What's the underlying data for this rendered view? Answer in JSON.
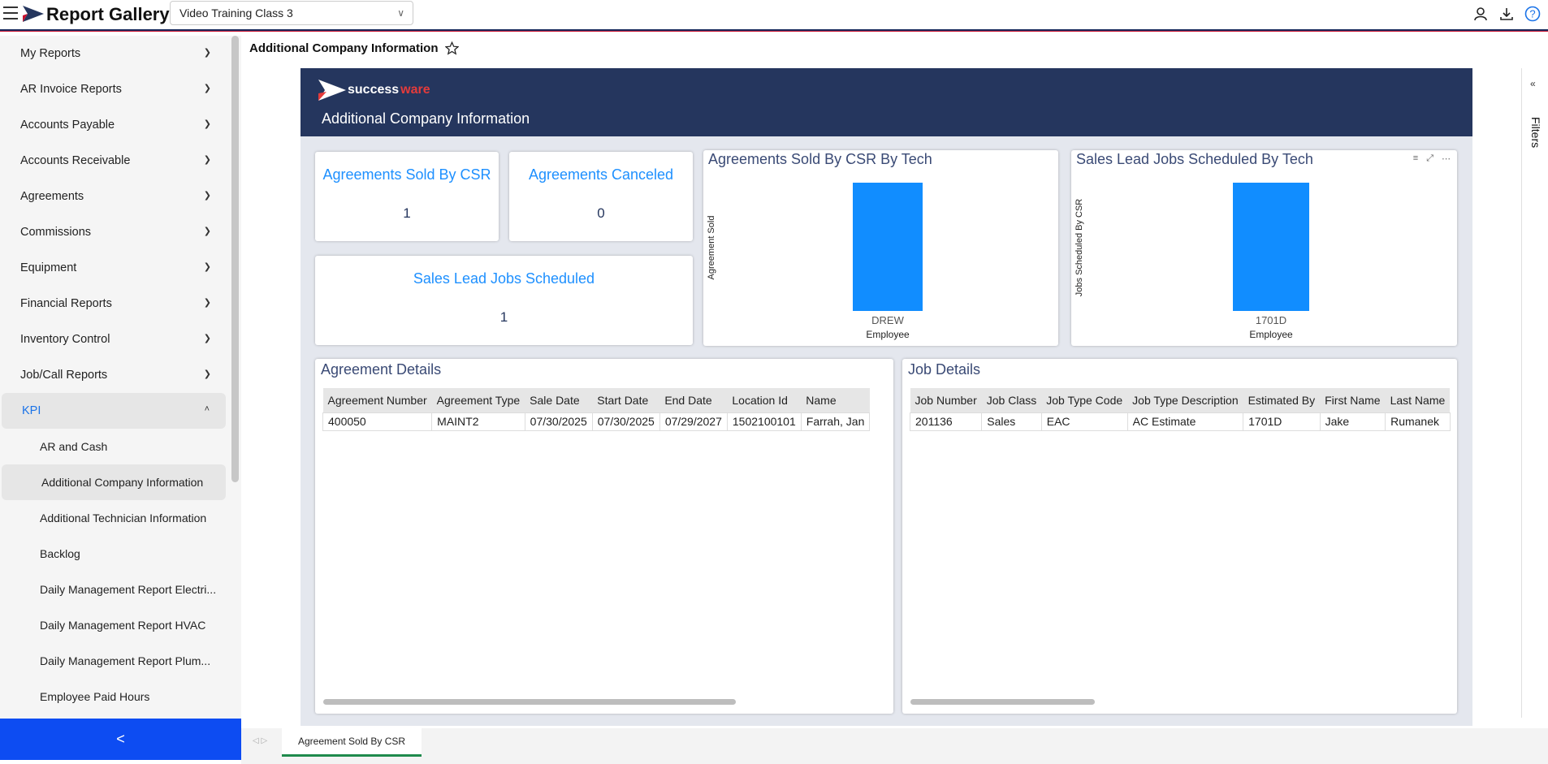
{
  "app": {
    "title": "Report Gallery",
    "workspace": "Video Training Class 3"
  },
  "sidebar": {
    "categories": [
      {
        "label": "My Reports"
      },
      {
        "label": "AR Invoice Reports"
      },
      {
        "label": "Accounts Payable"
      },
      {
        "label": "Accounts Receivable"
      },
      {
        "label": "Agreements"
      },
      {
        "label": "Commissions"
      },
      {
        "label": "Equipment"
      },
      {
        "label": "Financial Reports"
      },
      {
        "label": "Inventory Control"
      },
      {
        "label": "Job/Call Reports"
      },
      {
        "label": "KPI"
      }
    ],
    "kpi_items": [
      {
        "label": "AR and Cash"
      },
      {
        "label": "Additional Company Information"
      },
      {
        "label": "Additional Technician Information"
      },
      {
        "label": "Backlog"
      },
      {
        "label": "Daily Management Report Electri..."
      },
      {
        "label": "Daily Management Report HVAC"
      },
      {
        "label": "Daily Management Report Plum..."
      },
      {
        "label": "Employee Paid Hours"
      }
    ],
    "collapse_glyph": "<"
  },
  "page": {
    "title": "Additional Company Information"
  },
  "report": {
    "logo_text_1": "success",
    "logo_text_2": "ware",
    "subtitle": "Additional Company Information",
    "kpis": {
      "sold_by_csr": {
        "title": "Agreements Sold By CSR",
        "value": "1"
      },
      "canceled": {
        "title": "Agreements Canceled",
        "value": "0"
      },
      "sales_lead": {
        "title": "Sales Lead Jobs Scheduled",
        "value": "1"
      }
    },
    "charts": {
      "sold_by_tech": {
        "title": "Agreements Sold By CSR By Tech",
        "ylabel": "Agreement Sold",
        "xlabel": "Employee"
      },
      "lead_by_tech": {
        "title": "Sales Lead Jobs Scheduled By Tech",
        "ylabel": "Jobs Scheduled By CSR",
        "xlabel": "Employee"
      }
    },
    "agreement_details": {
      "title": "Agreement Details",
      "headers": [
        "Agreement Number",
        "Agreement Type",
        "Sale Date",
        "Start Date",
        "End Date",
        "Location Id",
        "Name"
      ],
      "rows": [
        [
          "400050",
          "MAINT2",
          "07/30/2025",
          "07/30/2025",
          "07/29/2027",
          "1502100101",
          "Farrah, Jan"
        ]
      ]
    },
    "job_details": {
      "title": "Job Details",
      "headers": [
        "Job Number",
        "Job Class",
        "Job Type Code",
        "Job Type Description",
        "Estimated By",
        "First Name",
        "Last Name"
      ],
      "rows": [
        [
          "201136",
          "Sales",
          "EAC",
          "AC Estimate",
          "1701D",
          "Jake",
          "Rumanek"
        ]
      ]
    }
  },
  "chart_data": [
    {
      "type": "bar",
      "title": "Agreements Sold By CSR By Tech",
      "xlabel": "Employee",
      "ylabel": "Agreement Sold",
      "categories": [
        "DREW"
      ],
      "values": [
        1
      ],
      "ylim": [
        0,
        1
      ],
      "color": "#118dff"
    },
    {
      "type": "bar",
      "title": "Sales Lead Jobs Scheduled By Tech",
      "xlabel": "Employee",
      "ylabel": "Jobs Scheduled By CSR",
      "categories": [
        "1701D"
      ],
      "values": [
        1
      ],
      "ylim": [
        0,
        1
      ],
      "color": "#118dff"
    }
  ],
  "filters": {
    "label": "Filters"
  },
  "bottom": {
    "tab": "Agreement Sold By CSR"
  },
  "colors": {
    "brand_navy": "#25365e",
    "accent_blue": "#1e90ff",
    "bar_blue": "#118dff",
    "sidebar_button": "#0d4cf2",
    "tab_underline": "#1f8a4c"
  }
}
